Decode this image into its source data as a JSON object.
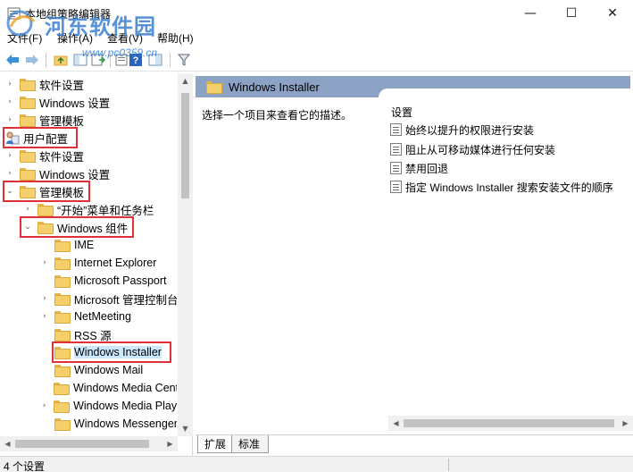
{
  "window": {
    "title": "本地组策略编辑器",
    "minimize_glyph": "—",
    "maximize_glyph": "☐",
    "close_glyph": "✕"
  },
  "watermark": {
    "title": "河东软件园",
    "url": "www.pc0359.cn"
  },
  "menu": [
    {
      "label": "文件(F)"
    },
    {
      "label": "操作(A)"
    },
    {
      "label": "查看(V)"
    },
    {
      "label": "帮助(H)"
    }
  ],
  "toolbar": {
    "icons": [
      "back-icon",
      "forward-icon",
      "up-folder-icon",
      "show-hide-tree-icon",
      "export-list-icon",
      "properties-icon",
      "help-icon",
      "extended-view-icon",
      "filter-icon"
    ]
  },
  "tree": {
    "items": [
      {
        "label": "软件设置",
        "expander": "›",
        "icon": "folder"
      },
      {
        "label": "Windows 设置",
        "expander": "›",
        "icon": "folder"
      },
      {
        "label": "管理模板",
        "expander": "›",
        "icon": "folder"
      },
      {
        "label": "用户配置",
        "expander": "",
        "icon": "user",
        "highlight": true
      },
      {
        "label": "软件设置",
        "expander": "›",
        "icon": "folder"
      },
      {
        "label": "Windows 设置",
        "expander": "›",
        "icon": "folder"
      },
      {
        "label": "管理模板",
        "expander": "⌄",
        "icon": "folder",
        "highlight": true
      },
      {
        "label": "“开始”菜单和任务栏",
        "expander": "›",
        "icon": "folder"
      },
      {
        "label": "Windows 组件",
        "expander": "⌄",
        "icon": "folder",
        "highlight": true
      },
      {
        "label": "IME",
        "expander": "",
        "icon": "folder"
      },
      {
        "label": "Internet Explorer",
        "expander": "›",
        "icon": "folder"
      },
      {
        "label": "Microsoft Passport",
        "expander": "",
        "icon": "folder"
      },
      {
        "label": "Microsoft 管理控制台",
        "expander": "›",
        "icon": "folder"
      },
      {
        "label": "NetMeeting",
        "expander": "›",
        "icon": "folder"
      },
      {
        "label": "RSS 源",
        "expander": "",
        "icon": "folder"
      },
      {
        "label": "Windows Installer",
        "expander": "",
        "icon": "folder",
        "highlight": true,
        "selected": true
      },
      {
        "label": "Windows Mail",
        "expander": "",
        "icon": "folder"
      },
      {
        "label": "Windows Media Center",
        "expander": "",
        "icon": "folder"
      },
      {
        "label": "Windows Media Player",
        "expander": "›",
        "icon": "folder"
      },
      {
        "label": "Windows Messenger",
        "expander": "",
        "icon": "folder"
      }
    ]
  },
  "content": {
    "header_title": "Windows Installer",
    "description": "选择一个项目来查看它的描述。",
    "settings_heading": "设置",
    "settings": [
      {
        "label": "始终以提升的权限进行安装"
      },
      {
        "label": "阻止从可移动媒体进行任何安装"
      },
      {
        "label": "禁用回退"
      },
      {
        "label": "指定 Windows Installer 搜索安装文件的顺序"
      }
    ]
  },
  "tabs": [
    {
      "label": "扩展",
      "active": true
    },
    {
      "label": "标准",
      "active": false
    }
  ],
  "status": {
    "text": "4 个设置"
  },
  "colors": {
    "header_band": "#8ca2c4",
    "highlight_box": "#e0303a",
    "selection": "#cce8ff",
    "folder": "#f4cf6b"
  }
}
